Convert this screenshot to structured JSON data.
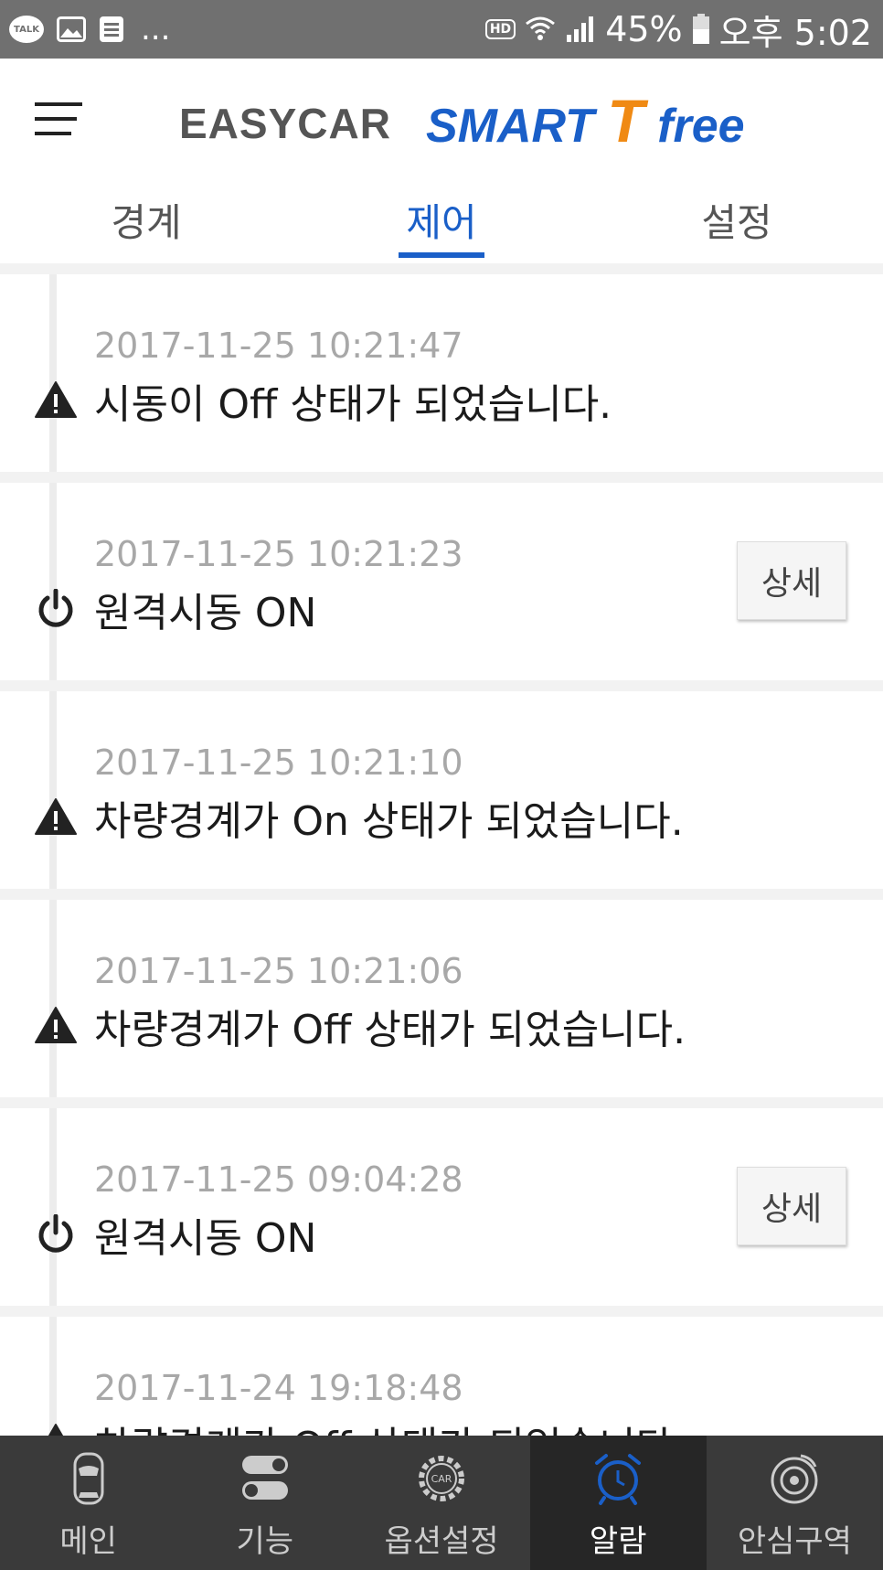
{
  "status_bar": {
    "talk_label": "TALK",
    "dots": "...",
    "hd_label": "HD",
    "battery": "45%",
    "time": "오후 5:02"
  },
  "header": {
    "logo_left": "EASYCAR",
    "logo_right_smart": "SMART",
    "logo_right_t": "T",
    "logo_right_free": "free"
  },
  "tabs": [
    {
      "label": "경계",
      "active": false
    },
    {
      "label": "제어",
      "active": true
    },
    {
      "label": "설정",
      "active": false
    }
  ],
  "alerts": [
    {
      "time": "2017-11-25 10:21:47",
      "message": "시동이 Off 상태가 되었습니다.",
      "icon": "warning-icon",
      "has_detail": false
    },
    {
      "time": "2017-11-25 10:21:23",
      "message": "원격시동 ON",
      "icon": "power-icon",
      "has_detail": true
    },
    {
      "time": "2017-11-25 10:21:10",
      "message": "차량경계가 On 상태가 되었습니다.",
      "icon": "warning-icon",
      "has_detail": false
    },
    {
      "time": "2017-11-25 10:21:06",
      "message": "차량경계가 Off 상태가 되었습니다.",
      "icon": "warning-icon",
      "has_detail": false
    },
    {
      "time": "2017-11-25 09:04:28",
      "message": "원격시동 ON",
      "icon": "power-icon",
      "has_detail": true
    },
    {
      "time": "2017-11-24 19:18:48",
      "message": "차량경계가 Off 상태가 되었습니다.",
      "icon": "warning-icon",
      "has_detail": false
    }
  ],
  "detail_label": "상세",
  "bottom_nav": [
    {
      "label": "메인",
      "icon": "car-icon",
      "active": false
    },
    {
      "label": "기능",
      "icon": "toggle-icon",
      "active": false
    },
    {
      "label": "옵션설정",
      "icon": "car-gear-icon",
      "active": false
    },
    {
      "label": "알람",
      "icon": "alarm-clock-icon",
      "active": true
    },
    {
      "label": "안심구역",
      "icon": "zone-target-icon",
      "active": false
    }
  ],
  "colors": {
    "accent": "#1a5fc8",
    "logo_orange": "#f08a14",
    "nav_bg": "#3a3a3a",
    "nav_active_bg": "#262626"
  }
}
